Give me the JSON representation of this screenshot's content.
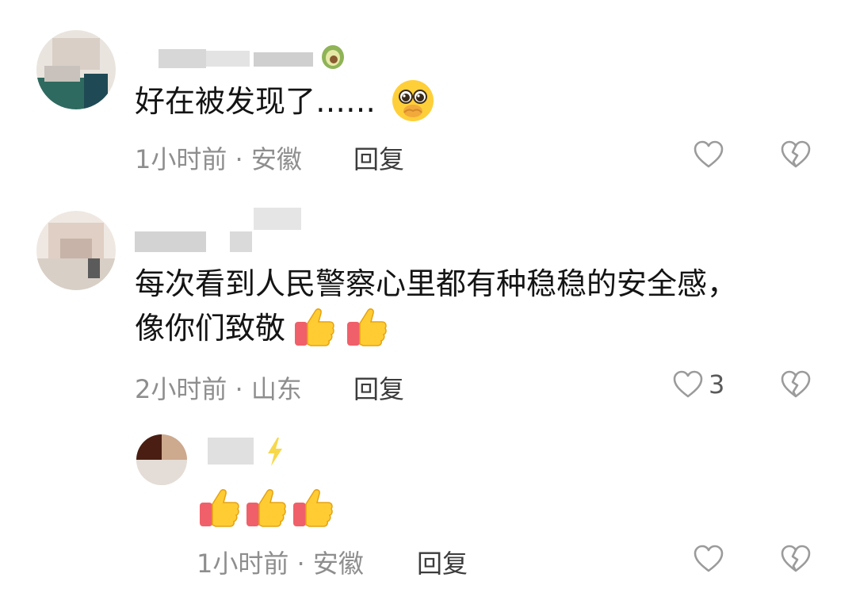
{
  "comments": [
    {
      "username": "",
      "badge_icon": "avocado-icon",
      "text": "好在被发现了……",
      "emoji": "pleading-face-icon",
      "time": "1小时前 · 安徽",
      "reply_label": "回复",
      "likes": ""
    },
    {
      "username": "",
      "text_line1": "每次看到人民警察心里都有种稳稳的安全感，",
      "text_line2": "像你们致敬",
      "emoji": "thumbs-up-icon",
      "time": "2小时前 · 山东",
      "reply_label": "回复",
      "likes": "3"
    },
    {
      "username": "",
      "badge_icon": "lightning-icon",
      "emoji": "thumbs-up-icon",
      "time": "1小时前 · 安徽",
      "reply_label": "回复",
      "likes": ""
    }
  ],
  "colors": {
    "meta": "#8e8e8e",
    "icon_stroke": "#9b9b9b",
    "reply": "#3c3c3c"
  }
}
